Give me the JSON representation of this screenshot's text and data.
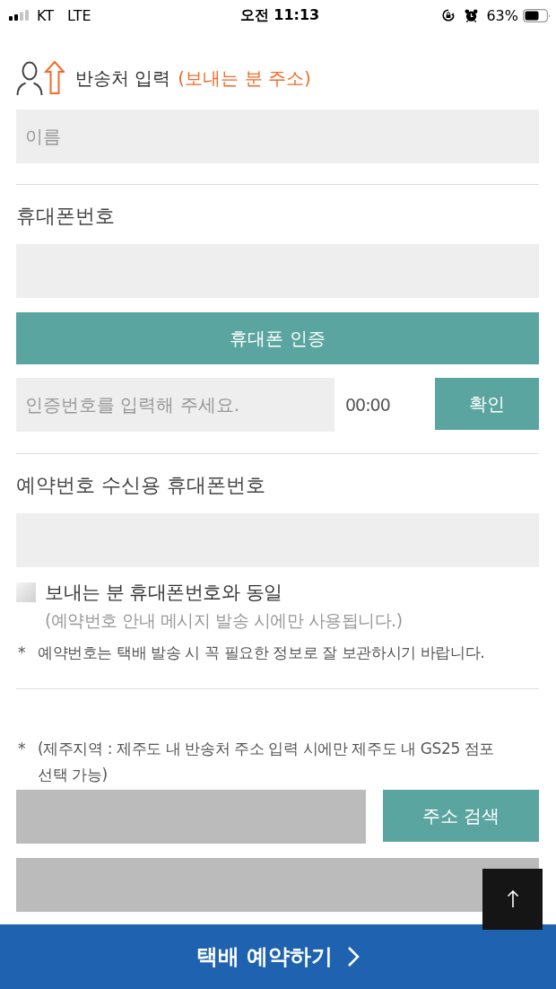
{
  "status_bar": {
    "carrier": "KT",
    "network": "LTE",
    "time": "오전 11:13",
    "battery": "63%"
  },
  "header": {
    "title": "반송처 입력",
    "subtitle": "(보내는 분 주소)"
  },
  "name_field": {
    "placeholder": "이름"
  },
  "phone_section": {
    "label": "휴대폰번호",
    "verify_button": "휴대폰 인증",
    "code_field": {
      "placeholder": "인증번호를 입력해 주세요."
    },
    "timer": "00:00",
    "confirm_button": "확인"
  },
  "reservation_phone_section": {
    "label": "예약번호 수신용 휴대폰번호",
    "same_as_sender": {
      "label": "보내는 분 휴대폰번호와 동일",
      "checked": false
    },
    "hint": "(예약번호 안내 메시지 발송 시에만 사용됩니다.)",
    "notice": {
      "marker": "*",
      "text": "예약번호는 택배 발송 시 꼭 필요한 정보로 잘 보관하시기 바랍니다."
    }
  },
  "address_section": {
    "notice": {
      "marker": "*",
      "text": "(제주지역 : 제주도 내 반송처 주소 입력 시에만 제주도 내 GS25 점포 선택 가능)"
    },
    "fields": [
      {
        "disabled": true
      },
      {
        "disabled": true
      }
    ],
    "search_button": "주소 검색"
  },
  "submit_button": {
    "label": "택배 예약하기"
  }
}
